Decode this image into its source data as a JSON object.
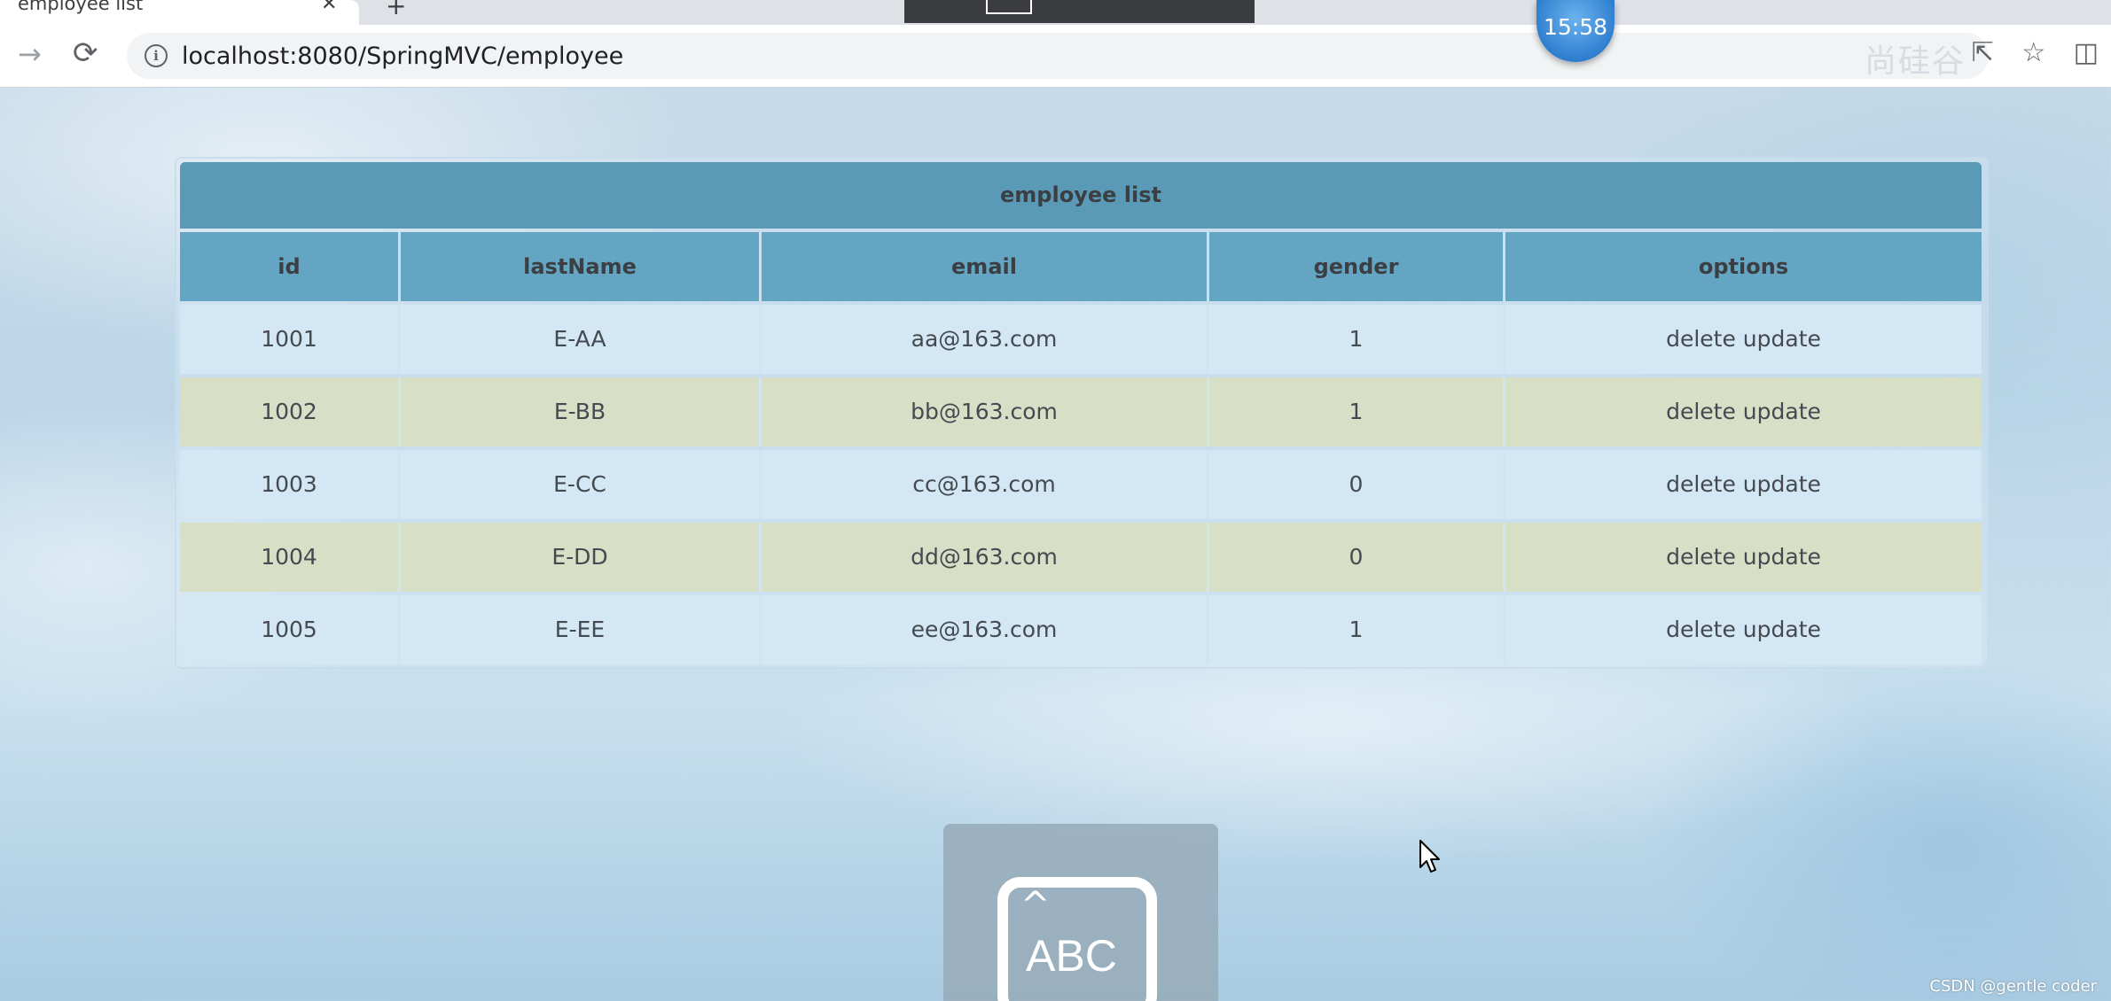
{
  "browser": {
    "tab_title": "employee list",
    "tab_close": "✕",
    "new_tab": "+",
    "url": "localhost:8080/SpringMVC/employee",
    "info_icon": "i",
    "forward_icon": "→",
    "reload_icon": "⟳",
    "share_icon": "⇱",
    "bookmark_icon": "☆",
    "menu_icon": "◫"
  },
  "overlay": {
    "timer": "15:58",
    "watermark_cn": "尚硅谷"
  },
  "table": {
    "caption": "employee list",
    "columns": [
      "id",
      "lastName",
      "email",
      "gender",
      "options"
    ],
    "rows": [
      {
        "id": "1001",
        "lastName": "E-AA",
        "email": "aa@163.com",
        "gender": "1",
        "options": "delete update"
      },
      {
        "id": "1002",
        "lastName": "E-BB",
        "email": "bb@163.com",
        "gender": "1",
        "options": "delete update"
      },
      {
        "id": "1003",
        "lastName": "E-CC",
        "email": "cc@163.com",
        "gender": "0",
        "options": "delete update"
      },
      {
        "id": "1004",
        "lastName": "E-DD",
        "email": "dd@163.com",
        "gender": "0",
        "options": "delete update"
      },
      {
        "id": "1005",
        "lastName": "E-EE",
        "email": "ee@163.com",
        "gender": "1",
        "options": "delete update"
      }
    ]
  },
  "keyboard_panel": {
    "caret": "^",
    "label": "ABC"
  },
  "footer": {
    "credit": "CSDN @gentle coder"
  },
  "colors": {
    "header_bg": "#5b9ab7",
    "odd_row": "#d4e7f4",
    "even_row": "#d7e0c7"
  }
}
